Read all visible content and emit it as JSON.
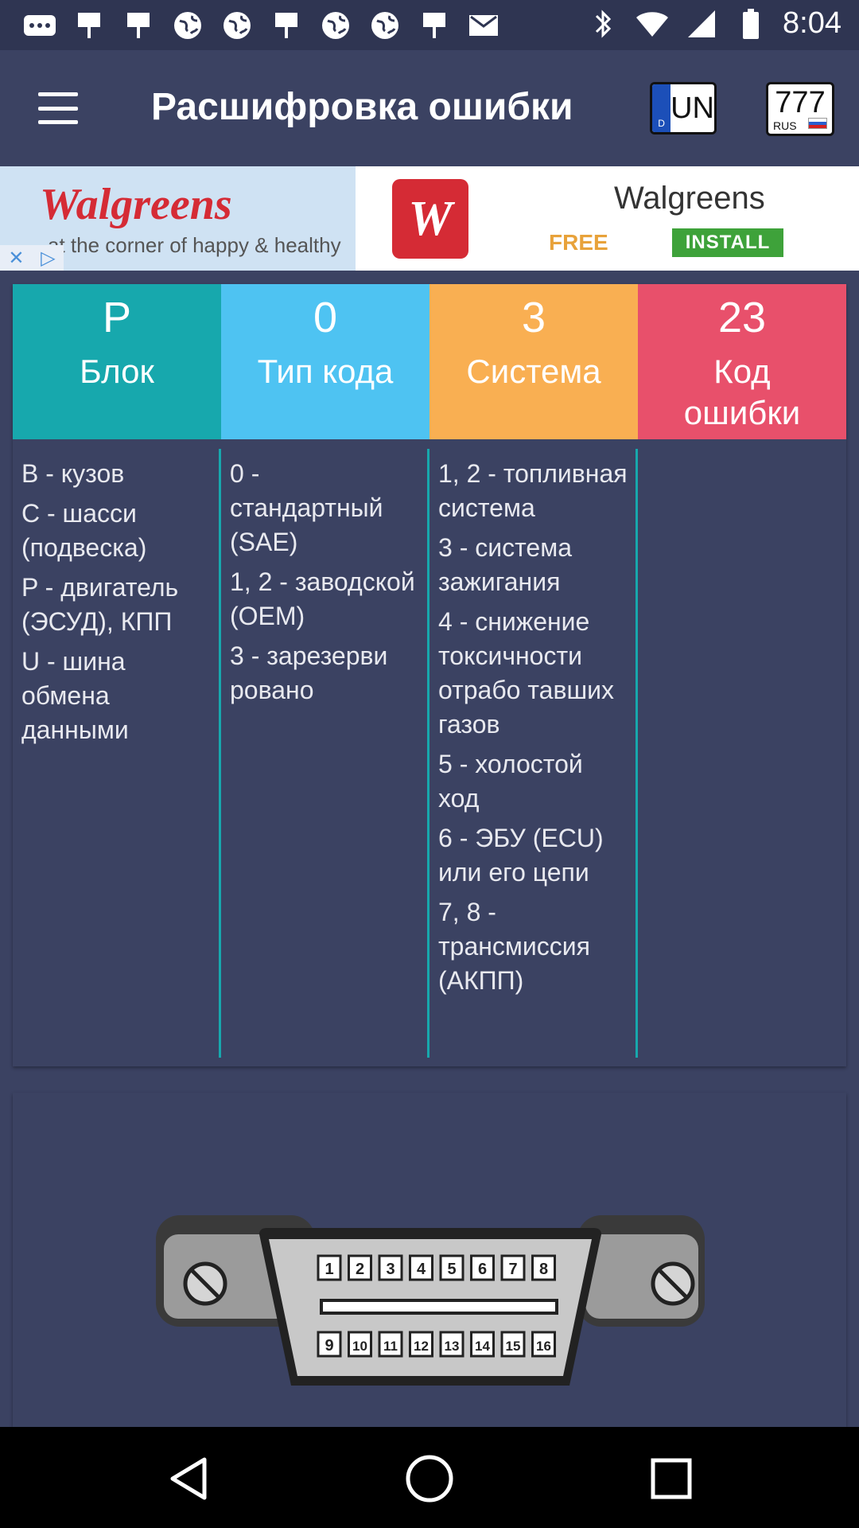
{
  "status_bar": {
    "time": "8:04",
    "left_icons": [
      "chat-icon",
      "flag-icon",
      "flag-icon",
      "globe-icon",
      "globe-icon",
      "flag-icon",
      "globe-icon",
      "globe-icon",
      "flag-icon",
      "mail-icon"
    ],
    "right_icons": [
      "bluetooth-icon",
      "wifi-icon",
      "signal-icon",
      "battery-icon"
    ]
  },
  "toolbar": {
    "title": "Расшифровка ошибки",
    "eu_plate": {
      "code": "UN",
      "country": "D"
    },
    "ru_plate": {
      "number": "777",
      "region": "RUS"
    }
  },
  "ad": {
    "brand": "Walgreens",
    "slogan": "at the corner of happy & healthy",
    "logo_letter": "W",
    "name": "Walgreens",
    "price": "FREE",
    "install": "INSTALL"
  },
  "code_table": {
    "headers": [
      {
        "value": "P",
        "label": "Блок"
      },
      {
        "value": "0",
        "label": "Тип кода"
      },
      {
        "value": "3",
        "label": "Система"
      },
      {
        "value": "23",
        "label": "Код ошибки"
      }
    ],
    "columns": [
      {
        "entries": [
          "B - кузов",
          "C - шасси (подвеска)",
          "P - двигатель (ЭСУД), КПП",
          "U - шина обмена данными"
        ]
      },
      {
        "entries": [
          "0 - стандартный (SAE)",
          "1, 2 - заводской (OEM)",
          "3 - зарезерви ровано"
        ]
      },
      {
        "entries": [
          "1, 2 - топливная система",
          "3 - система зажигания",
          "4 - снижение токсичности отрабо тавших газов",
          "5 - холостой ход",
          "6 - ЭБУ (ECU) или его цепи",
          "7, 8 - трансмиссия (АКПП)"
        ]
      },
      {
        "entries": []
      }
    ],
    "colors": {
      "block": "#17a8ad",
      "type": "#4ec3f2",
      "system": "#f9af52",
      "code": "#e8506b"
    }
  },
  "connector": {
    "pins_top": [
      "1",
      "2",
      "3",
      "4",
      "5",
      "6",
      "7",
      "8"
    ],
    "pins_bottom": [
      "9",
      "10",
      "11",
      "12",
      "13",
      "14",
      "15",
      "16"
    ]
  },
  "navbar": {
    "icons": [
      "back-icon",
      "home-icon",
      "recents-icon"
    ]
  }
}
